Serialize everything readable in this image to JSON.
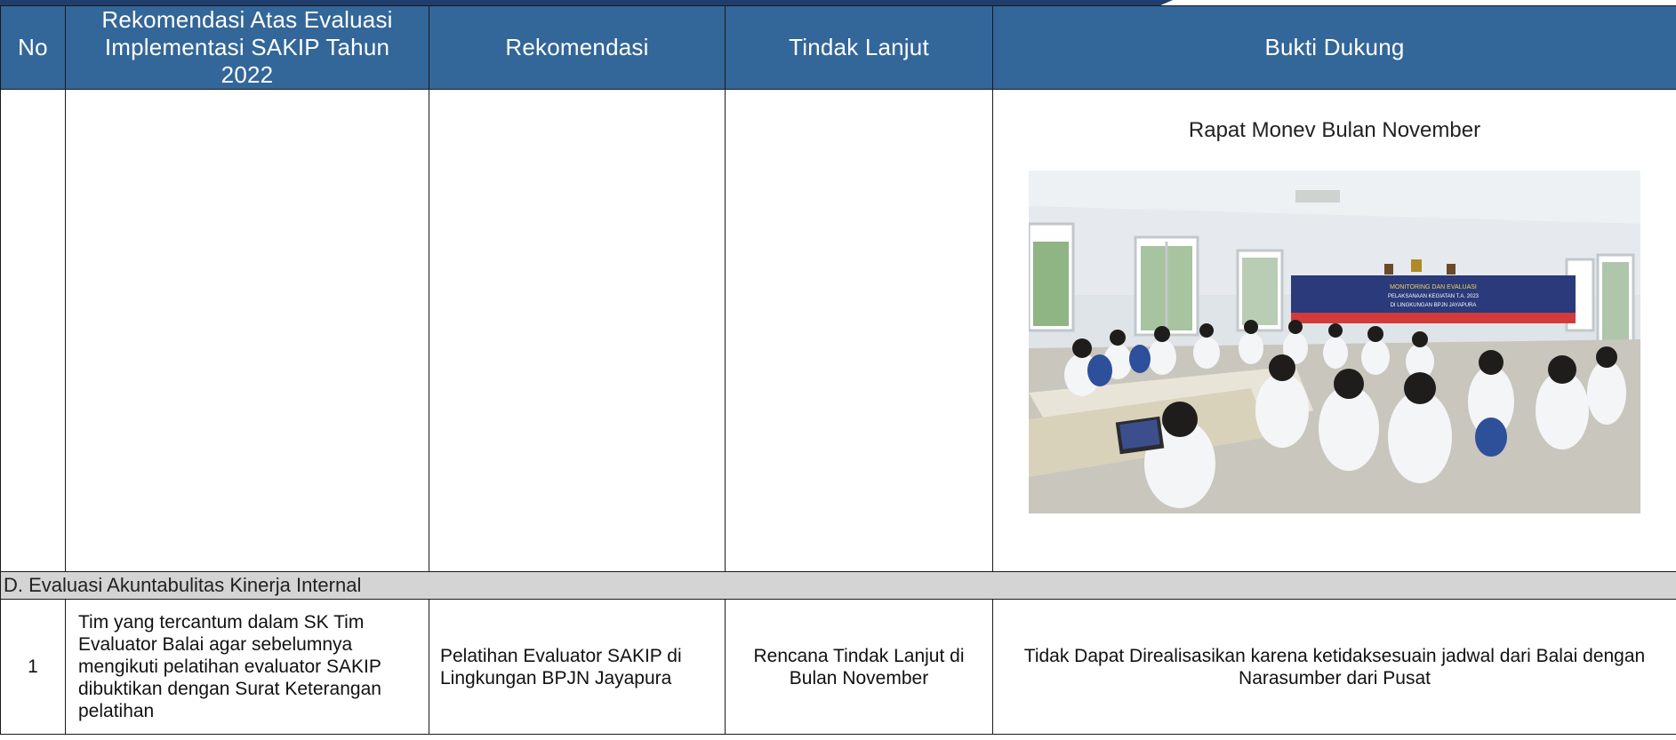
{
  "header": {
    "no": "No",
    "rekomendasi_evaluasi": "Rekomendasi Atas Evaluasi Implementasi SAKIP Tahun 2022",
    "rekomendasi": "Rekomendasi",
    "tindak_lanjut": "Tindak Lanjut",
    "bukti_dukung": "Bukti Dukung"
  },
  "evidence_row": {
    "caption": "Rapat Monev Bulan November",
    "banner_line1": "MONITORING DAN EVALUASI",
    "banner_line2": "PELAKSANAAN KEGIATAN T.A. 2023",
    "banner_line3": "DI LINGKUNGAN BPJN JAYAPURA"
  },
  "section": {
    "title": "D. Evaluasi Akuntabulitas Kinerja Internal"
  },
  "row1": {
    "no": "1",
    "rekomendasi_evaluasi": "Tim yang tercantum dalam SK Tim Evaluator Balai agar sebelumnya mengikuti pelatihan evaluator SAKIP dibuktikan dengan Surat Keterangan pelatihan",
    "rekomendasi": "Pelatihan Evaluator SAKIP di Lingkungan BPJN Jayapura",
    "tindak_lanjut": "Rencana Tindak Lanjut di Bulan November",
    "bukti_dukung": "Tidak Dapat Direalisasikan karena ketidaksesuain jadwal dari Balai dengan Narasumber dari Pusat"
  }
}
